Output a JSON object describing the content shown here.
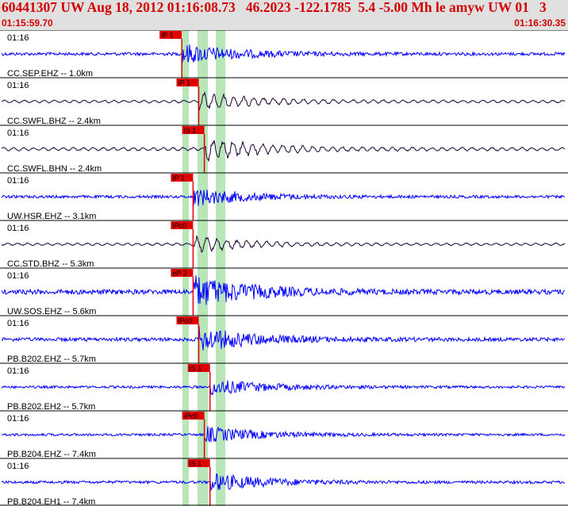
{
  "header": {
    "title": "60441307 UW Aug 18, 2012 01:16:08.73   46.2023 -122.1785  5.4 -5.00 Mh le amyw UW 01   3",
    "start_time": "01:15:59.70",
    "end_time": "01:16:30.35"
  },
  "colors": {
    "header_text": "#d40000",
    "header_bg": "#e0e0e0",
    "trace_blue": "#0000ff",
    "trace_dark": "#1a0033",
    "pick_red": "#e00000",
    "window_green": "#b8e6b8",
    "row_divider": "#000000"
  },
  "traces": [
    {
      "station": "CC.SEP.EHZ -- 1.0km",
      "time_label": "01:16",
      "pick": "iP 1",
      "color": "blue",
      "amp": 10,
      "onset": 0.32
    },
    {
      "station": "CC.SWFL.BHZ -- 2.4km",
      "time_label": "01:16",
      "pick": "iP 1",
      "color": "dark",
      "amp": 8,
      "onset": 0.35
    },
    {
      "station": "CC.SWFL.BHN -- 2.4km",
      "time_label": "01:16",
      "pick": "iS 1",
      "color": "dark",
      "amp": 10,
      "onset": 0.36
    },
    {
      "station": "UW.HSR.EHZ -- 3.1km",
      "time_label": "01:16",
      "pick": "iP 1",
      "color": "blue",
      "amp": 9,
      "onset": 0.34
    },
    {
      "station": "CC.STD.BHZ -- 5.3km",
      "time_label": "01:16",
      "pick": "iPc0",
      "color": "dark",
      "amp": 7,
      "onset": 0.34
    },
    {
      "station": "UW.SOS.EHZ -- 5.6km",
      "time_label": "01:16",
      "pick": "eP 2",
      "color": "blue",
      "amp": 16,
      "onset": 0.34
    },
    {
      "station": "PB.B202.EHZ -- 5.7km",
      "time_label": "01:16",
      "pick": "iPc0",
      "color": "blue",
      "amp": 12,
      "onset": 0.35
    },
    {
      "station": "PB.B202.EH2 -- 5.7km",
      "time_label": "01:16",
      "pick": "iS 1",
      "color": "blue",
      "amp": 8,
      "onset": 0.37
    },
    {
      "station": "PB.B204.EHZ -- 7.4km",
      "time_label": "01:16",
      "pick": "iPc0",
      "color": "blue",
      "amp": 8,
      "onset": 0.36
    },
    {
      "station": "PB.B204.EH1 -- 7.4km",
      "time_label": "01:16",
      "pick": "iS 1",
      "color": "blue",
      "amp": 9,
      "onset": 0.37
    }
  ]
}
